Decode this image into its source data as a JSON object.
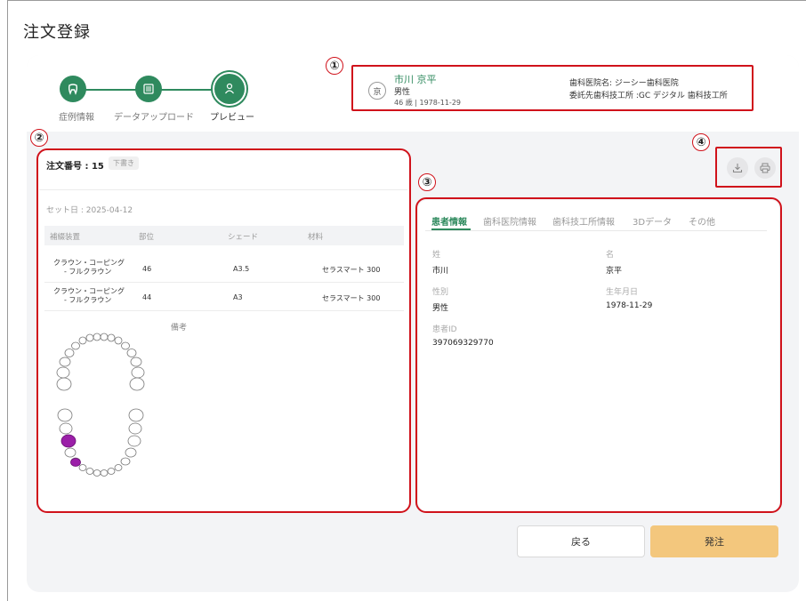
{
  "page_title": "注文登録",
  "stepper": [
    {
      "label": "症例情報",
      "icon": "tooth-icon"
    },
    {
      "label": "データアップロード",
      "icon": "data-grid-icon"
    },
    {
      "label": "プレビュー",
      "icon": "person-icon"
    }
  ],
  "annotations": [
    "①",
    "②",
    "③",
    "④"
  ],
  "patient": {
    "avatar": "京",
    "name": "市川 京平",
    "gender": "男性",
    "age_birth": "46 歳 | 1978-11-29"
  },
  "clinic": {
    "clinic_line": "歯科医院名:  ジーシー歯科医院",
    "lab_line": "委託先歯科技工所 :GC デジタル 歯科技工所"
  },
  "order": {
    "number_label": "注文番号 : 15",
    "status": "下書き",
    "set_date": "セット日 : 2025-04-12",
    "columns": [
      "補綴装置",
      "部位",
      "シェード",
      "材料"
    ],
    "rows": [
      {
        "device1": "クラウン・コーピング",
        "device2": "- フルクラウン",
        "site": "46",
        "shade": "A3.5",
        "material": "セラスマート 300"
      },
      {
        "device1": "クラウン・コーピング",
        "device2": "- フルクラウン",
        "site": "44",
        "shade": "A3",
        "material": "セラスマート 300"
      }
    ],
    "remarks_label": "備考"
  },
  "tabs": [
    "患者情報",
    "歯科医院情報",
    "歯科技工所情報",
    "3Dデータ",
    "その他"
  ],
  "patient_info": {
    "last_name_label": "姓",
    "last_name": "市川",
    "first_name_label": "名",
    "first_name": "京平",
    "gender_label": "性別",
    "gender": "男性",
    "birth_label": "生年月日",
    "birth": "1978-11-29",
    "id_label": "患者ID",
    "id": "397069329770"
  },
  "actions": {
    "download_icon": "download-icon",
    "print_icon": "print-icon"
  },
  "buttons": {
    "back": "戻る",
    "submit": "発注"
  },
  "colors": {
    "accent": "#2f8a5e",
    "annotation": "#d0121b",
    "submit": "#f3c77d",
    "selected_tooth": "#9b1fa8"
  }
}
